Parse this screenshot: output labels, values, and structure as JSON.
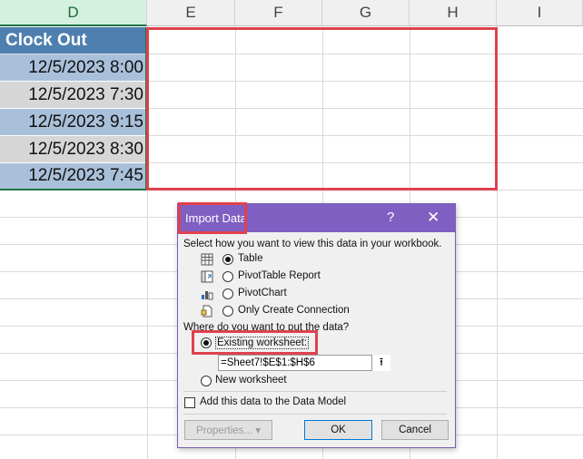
{
  "columns": [
    "D",
    "E",
    "F",
    "G",
    "H",
    "I"
  ],
  "sheet": {
    "header": "Clock Out",
    "values": [
      "12/5/2023 8:00",
      "12/5/2023 7:30",
      "12/5/2023 9:15",
      "12/5/2023 8:30",
      "12/5/2023 7:45"
    ],
    "header_color": "#4e7fae",
    "row_colors": [
      "#a9c0da",
      "#d6d6d6"
    ]
  },
  "dialog": {
    "title": "Import Data",
    "help": "?",
    "close": "✕",
    "prompt_view": "Select how you want to view this data in your workbook.",
    "view_options": [
      {
        "label": "Table",
        "selected": true,
        "icon": "table-icon"
      },
      {
        "label": "PivotTable Report",
        "selected": false,
        "icon": "pivottable-icon"
      },
      {
        "label": "PivotChart",
        "selected": false,
        "icon": "pivotchart-icon"
      },
      {
        "label": "Only Create Connection",
        "selected": false,
        "icon": "connection-icon"
      }
    ],
    "prompt_location": "Where do you want to put the data?",
    "existing_label": "Existing worksheet:",
    "existing_selected": true,
    "range_value": "=Sheet7!$E$1:$H$6",
    "range_button": "⭱",
    "new_label": "New worksheet",
    "data_model_label": "Add this data to the Data Model",
    "properties_label": "Properties... ▾",
    "ok_label": "OK",
    "cancel_label": "Cancel",
    "title_color": "#7f5fc2"
  },
  "highlight_color": "#e0414e"
}
